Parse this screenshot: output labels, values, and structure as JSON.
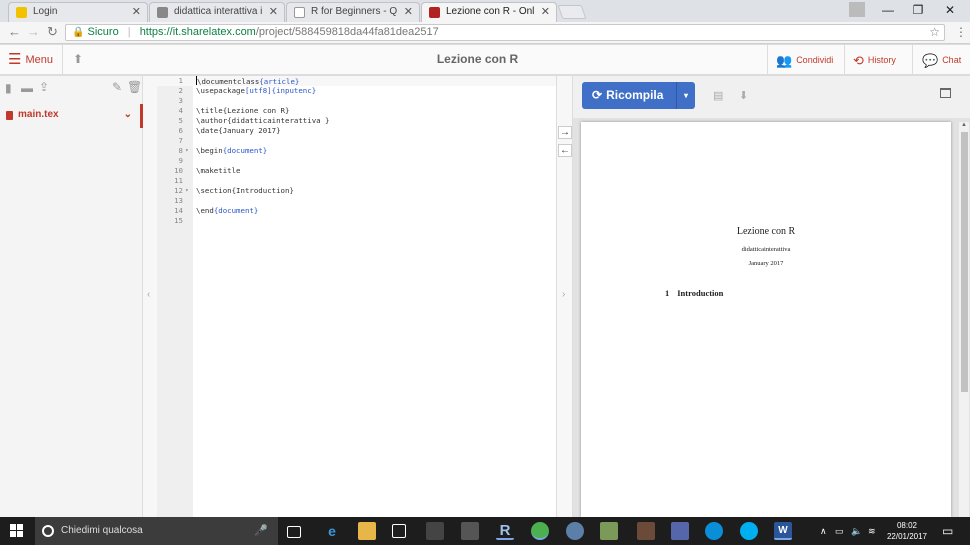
{
  "browser": {
    "tabs": [
      {
        "label": "Login",
        "favicon_color": "#f2c200"
      },
      {
        "label": "didattica interattiva inte",
        "favicon_color": "#888888"
      },
      {
        "label": "R for Beginners - Quanti",
        "favicon_color": "#999999"
      },
      {
        "label": "Lezione con R - Online L",
        "favicon_color": "#b22222",
        "active": true
      }
    ],
    "secure_label": "Sicuro",
    "url_host": "https://it.sharelatex.com",
    "url_path": "/project/588459818da44fa81dea2517"
  },
  "header": {
    "menu_label": "Menu",
    "project_title": "Lezione con R",
    "share_label": "Condividi",
    "history_label": "History",
    "chat_label": "Chat"
  },
  "filetree": {
    "files": [
      {
        "name": "main.tex",
        "selected": true
      }
    ]
  },
  "editor": {
    "lines": [
      {
        "n": "1",
        "cmd": "\\documentclass",
        "arg": "{article}",
        "rest": ""
      },
      {
        "n": "2",
        "cmd": "\\usepackage",
        "arg": "[utf8]",
        "rest": "",
        "arg2": "{inputenc}"
      },
      {
        "n": "3",
        "cmd": "",
        "arg": "",
        "rest": ""
      },
      {
        "n": "4",
        "cmd": "\\title",
        "arg": "",
        "rest": "{Lezione con R}"
      },
      {
        "n": "5",
        "cmd": "\\author",
        "arg": "",
        "rest": "{didatticainterattiva }"
      },
      {
        "n": "6",
        "cmd": "\\date",
        "arg": "",
        "rest": "{January 2017}"
      },
      {
        "n": "7",
        "cmd": "",
        "arg": "",
        "rest": ""
      },
      {
        "n": "8",
        "cmd": "\\begin",
        "arg": "{document}",
        "rest": "",
        "fold": true
      },
      {
        "n": "9",
        "cmd": "",
        "arg": "",
        "rest": ""
      },
      {
        "n": "10",
        "cmd": "\\maketitle",
        "arg": "",
        "rest": ""
      },
      {
        "n": "11",
        "cmd": "",
        "arg": "",
        "rest": ""
      },
      {
        "n": "12",
        "cmd": "\\section",
        "arg": "",
        "rest": "{Introduction}",
        "fold": true
      },
      {
        "n": "13",
        "cmd": "",
        "arg": "",
        "rest": ""
      },
      {
        "n": "14",
        "cmd": "\\end",
        "arg": "{document}",
        "rest": ""
      },
      {
        "n": "15",
        "cmd": "",
        "arg": "",
        "rest": ""
      }
    ]
  },
  "preview": {
    "recompile_label": "Ricompila",
    "pdf": {
      "title": "Lezione con R",
      "author": "didatticainterattiva",
      "date": "January 2017",
      "section_number": "1",
      "section_title": "Introduction"
    }
  },
  "taskbar": {
    "search_placeholder": "Chiedimi qualcosa",
    "time": "08:02",
    "date": "22/01/2017"
  },
  "colors": {
    "accent": "#c0392b",
    "recompile": "#3f6fc7"
  }
}
